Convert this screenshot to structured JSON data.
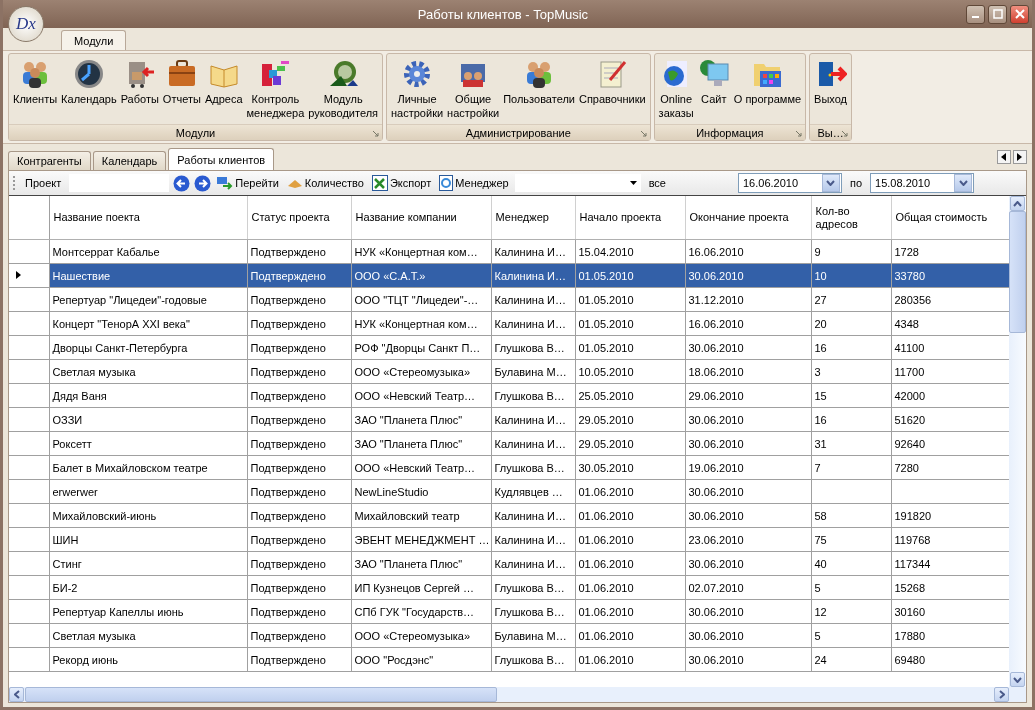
{
  "window": {
    "logo": "Dx",
    "title": "Работы клиентов - TopMusic"
  },
  "ribbon": {
    "tabs": [
      {
        "label": "Модули",
        "selected": true
      }
    ],
    "groups": [
      {
        "title": "Модули",
        "buttons": [
          {
            "lines": [
              "Клиенты"
            ]
          },
          {
            "lines": [
              "Календарь"
            ]
          },
          {
            "lines": [
              "Работы"
            ]
          },
          {
            "lines": [
              "Отчеты"
            ]
          },
          {
            "lines": [
              "Адреса"
            ]
          },
          {
            "lines": [
              "Контроль",
              "менеджера"
            ]
          },
          {
            "lines": [
              "Модуль",
              "руководителя"
            ]
          }
        ]
      },
      {
        "title": "Администрирование",
        "buttons": [
          {
            "lines": [
              "Личные",
              "настройки"
            ]
          },
          {
            "lines": [
              "Общие",
              "настройки"
            ]
          },
          {
            "lines": [
              "Пользователи"
            ]
          },
          {
            "lines": [
              "Справочники"
            ]
          }
        ]
      },
      {
        "title": "Информация",
        "buttons": [
          {
            "lines": [
              "Online",
              "заказы"
            ]
          },
          {
            "lines": [
              "Сайт"
            ]
          },
          {
            "lines": [
              "О программе"
            ]
          }
        ]
      },
      {
        "title": "Вы…",
        "buttons": [
          {
            "lines": [
              "Выход"
            ]
          }
        ]
      }
    ]
  },
  "doc_tabs": [
    {
      "label": "Контрагенты",
      "selected": false
    },
    {
      "label": "Календарь",
      "selected": false
    },
    {
      "label": "Работы клиентов",
      "selected": true
    }
  ],
  "toolbar": {
    "project_label": "Проект",
    "goto": "Перейти",
    "count": "Количество",
    "export": "Экспорт",
    "manager": "Менеджер",
    "all": "все",
    "date_from": "16.06.2010",
    "to_label": "по",
    "date_to": "15.08.2010"
  },
  "table": {
    "columns": [
      "Название поекта",
      "Статус проекта",
      "Название компании",
      "Менеджер",
      "Начало проекта",
      "Окончание проекта",
      "Кол-во адресов",
      "Общая стоимость"
    ],
    "rows": [
      {
        "selected": false,
        "cells": [
          "Монтсеррат Кабалье",
          "Подтверждено",
          "НУК «Концертная ком…",
          "Калинина И…",
          "15.04.2010",
          "16.06.2010",
          "9",
          "1728"
        ]
      },
      {
        "selected": true,
        "cells": [
          "Нашествие",
          "Подтверждено",
          "ООО «С.А.Т.»",
          "Калинина И…",
          "01.05.2010",
          "30.06.2010",
          "10",
          "33780"
        ]
      },
      {
        "selected": false,
        "cells": [
          "Репертуар \"Лицедеи\"-годовые",
          "Подтверждено",
          "ООО \"ТЦТ \"Лицедеи\"-…",
          "Калинина И…",
          "01.05.2010",
          "31.12.2010",
          "27",
          "280356"
        ]
      },
      {
        "selected": false,
        "cells": [
          "Концерт \"ТенорА  XXI века\"",
          "Подтверждено",
          "НУК «Концертная ком…",
          "Калинина И…",
          "01.05.2010",
          "16.06.2010",
          "20",
          "4348"
        ]
      },
      {
        "selected": false,
        "cells": [
          "Дворцы Санкт-Петербурга",
          "Подтверждено",
          "РОФ \"Дворцы Санкт П…",
          "Глушкова В…",
          "01.05.2010",
          "30.06.2010",
          "16",
          "41100"
        ]
      },
      {
        "selected": false,
        "cells": [
          "Светлая музыка",
          "Подтверждено",
          "ООО «Стереомузыка»",
          "Булавина М…",
          "10.05.2010",
          "18.06.2010",
          "3",
          "11700"
        ]
      },
      {
        "selected": false,
        "cells": [
          "Дядя Ваня",
          "Подтверждено",
          "ООО «Невский Театр…",
          "Глушкова В…",
          "25.05.2010",
          "29.06.2010",
          "15",
          "42000"
        ]
      },
      {
        "selected": false,
        "cells": [
          "ОЗЗИ",
          "Подтверждено",
          "ЗАО \"Планета Плюс\"",
          "Калинина И…",
          "29.05.2010",
          "30.06.2010",
          "16",
          "51620"
        ]
      },
      {
        "selected": false,
        "cells": [
          "Роксетт",
          "Подтверждено",
          "ЗАО \"Планета Плюс\"",
          "Калинина И…",
          "29.05.2010",
          "30.06.2010",
          "31",
          "92640"
        ]
      },
      {
        "selected": false,
        "cells": [
          "Балет в Михайловском театре",
          "Подтверждено",
          "ООО «Невский Театр…",
          "Глушкова В…",
          "30.05.2010",
          "19.06.2010",
          "7",
          "7280"
        ]
      },
      {
        "selected": false,
        "cells": [
          "erwerwer",
          "Подтверждено",
          "NewLineStudio",
          "Кудлявцев …",
          "01.06.2010",
          "30.06.2010",
          "",
          ""
        ]
      },
      {
        "selected": false,
        "cells": [
          "Михайловский-июнь",
          "Подтверждено",
          "Михайловский театр",
          "Калинина И…",
          "01.06.2010",
          "30.06.2010",
          "58",
          "191820"
        ]
      },
      {
        "selected": false,
        "cells": [
          "ШИН",
          "Подтверждено",
          "ЭВЕНТ МЕНЕДЖМЕНТ …",
          "Калинина И…",
          "01.06.2010",
          "23.06.2010",
          "75",
          "119768"
        ]
      },
      {
        "selected": false,
        "cells": [
          "Стинг",
          "Подтверждено",
          "ЗАО \"Планета Плюс\"",
          "Калинина И…",
          "01.06.2010",
          "30.06.2010",
          "40",
          "117344"
        ]
      },
      {
        "selected": false,
        "cells": [
          "БИ-2",
          "Подтверждено",
          "ИП Кузнецов Сергей …",
          "Глушкова В…",
          "01.06.2010",
          "02.07.2010",
          "5",
          "15268"
        ]
      },
      {
        "selected": false,
        "cells": [
          "Репертуар Капеллы июнь",
          "Подтверждено",
          "СПб ГУК \"Государств…",
          "Глушкова В…",
          "01.06.2010",
          "30.06.2010",
          "12",
          "30160"
        ]
      },
      {
        "selected": false,
        "cells": [
          "Светлая музыка",
          "Подтверждено",
          "ООО «Стереомузыка»",
          "Булавина М…",
          "01.06.2010",
          "30.06.2010",
          "5",
          "17880"
        ]
      },
      {
        "selected": false,
        "cells": [
          "Рекорд июнь",
          "Подтверждено",
          "ООО \"Росдэнс\"",
          "Глушкова В…",
          "01.06.2010",
          "30.06.2010",
          "24",
          "69480"
        ]
      }
    ]
  }
}
